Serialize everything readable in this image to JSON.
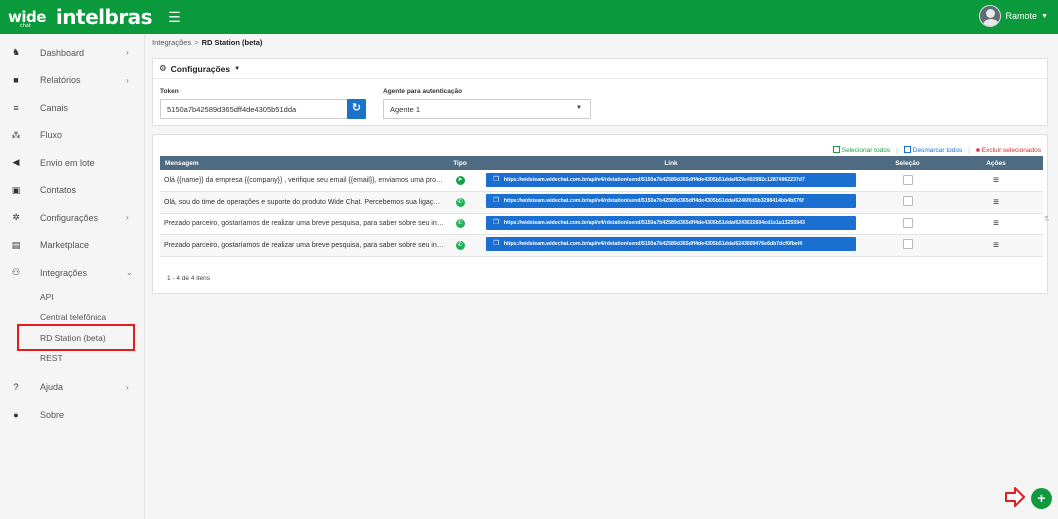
{
  "brand": {
    "wide": "wide",
    "chat": "chat",
    "name": "intelbras"
  },
  "header": {
    "menu_icon": "hamburger-icon",
    "user_name": "Ramote",
    "user_caret": "▼"
  },
  "sidebar": {
    "items": [
      {
        "label": "Dashboard",
        "icon": "dashboard-icon",
        "glyph": "♞",
        "arrow": "›"
      },
      {
        "label": "Relatórios",
        "icon": "report-icon",
        "glyph": "■",
        "arrow": "›"
      },
      {
        "label": "Canais",
        "icon": "channels-icon",
        "glyph": "≡",
        "arrow": ""
      },
      {
        "label": "Fluxo",
        "icon": "flow-icon",
        "glyph": "⁂",
        "arrow": ""
      },
      {
        "label": "Envio em lote",
        "icon": "send-icon",
        "glyph": "◀",
        "arrow": ""
      },
      {
        "label": "Contatos",
        "icon": "contacts-icon",
        "glyph": "▣",
        "arrow": ""
      },
      {
        "label": "Configurações",
        "icon": "settings-icon",
        "glyph": "✲",
        "arrow": "›"
      },
      {
        "label": "Marketplace",
        "icon": "marketplace-icon",
        "glyph": "▤",
        "arrow": ""
      },
      {
        "label": "Integrações",
        "icon": "integrations-icon",
        "glyph": "⚇",
        "arrow": "⌄"
      }
    ],
    "subitems": [
      "API",
      "Central telefônica",
      "RD Station (beta)",
      "REST"
    ],
    "bottom_items": [
      {
        "label": "Ajuda",
        "icon": "help-icon",
        "glyph": "?",
        "arrow": "›"
      },
      {
        "label": "Sobre",
        "icon": "info-icon",
        "glyph": "●",
        "arrow": ""
      }
    ]
  },
  "breadcrumb": {
    "parent": "Integrações",
    "separator": ">",
    "current": "RD Station (beta)"
  },
  "config": {
    "title": "Configurações",
    "caret": "▼",
    "token_label": "Token",
    "token_value": "5150a7b42589d365dff4de4305b51dda",
    "agent_label": "Agente para autenticação",
    "agent_value": "Agente 1"
  },
  "bulk": {
    "select_all": "Selecionar todos",
    "divider": "|",
    "unselect_all": "Desmarcar todos",
    "delete_selected": "Excluir selecionados"
  },
  "table": {
    "headers": {
      "message": "Mensagem",
      "type": "Tipo",
      "link": "Link",
      "selection": "Seleção",
      "actions": "Ações"
    },
    "rows": [
      {
        "message": "Olá {{name}} da empresa {{company}} , verifique seu email {{email}}, enviamos uma proposta...",
        "type": "telegram",
        "type_glyph": "➤",
        "link": "https://widsteam.widechat.com.br/api/v4/rdstation/send/5150a7b42589d365dff4de4305b51dda/629e492982c12874962237d7"
      },
      {
        "message": "Olá, sou do time de operações e suporte do produto Wide Chat. Percebemos sua ligação e go...",
        "type": "whatsapp",
        "type_glyph": "✆",
        "link": "https://widsteam.widechat.com.br/api/v4/rdstation/send/5150a7b42589d365dff4de4305b51dda/6246f0d5b3298414bb4b576f"
      },
      {
        "message": "Prezado parceiro, gostaríamos de realizar uma breve pesquisa, para saber sobre seu interessa...",
        "type": "whatsapp",
        "type_glyph": "✆",
        "link": "https://widsteam.widechat.com.br/api/v4/rdstation/send/5150a7b42589d365dff4de4305b51dda/6243622604ed1e1a13255943"
      },
      {
        "message": "Prezado parceiro, gostaríamos de realizar uma breve pesquisa, para saber sobre seu interessa...",
        "type": "whatsapp",
        "type_glyph": "✆",
        "link": "https://widsteam.widechat.com.br/api/v4/rdstation/send/5150a7b42589d365dff4de4305b51dda/6243609476e6db7dcf0fbef4"
      }
    ],
    "pager": "1 - 4 de 4 itens"
  },
  "fab": {
    "label": "+",
    "icon": "add-icon"
  },
  "colors": {
    "topbar": "#0a9a3b",
    "table_header": "#4e6b82",
    "link_button": "#1b6fd0",
    "highlight": "#e11d1d"
  }
}
